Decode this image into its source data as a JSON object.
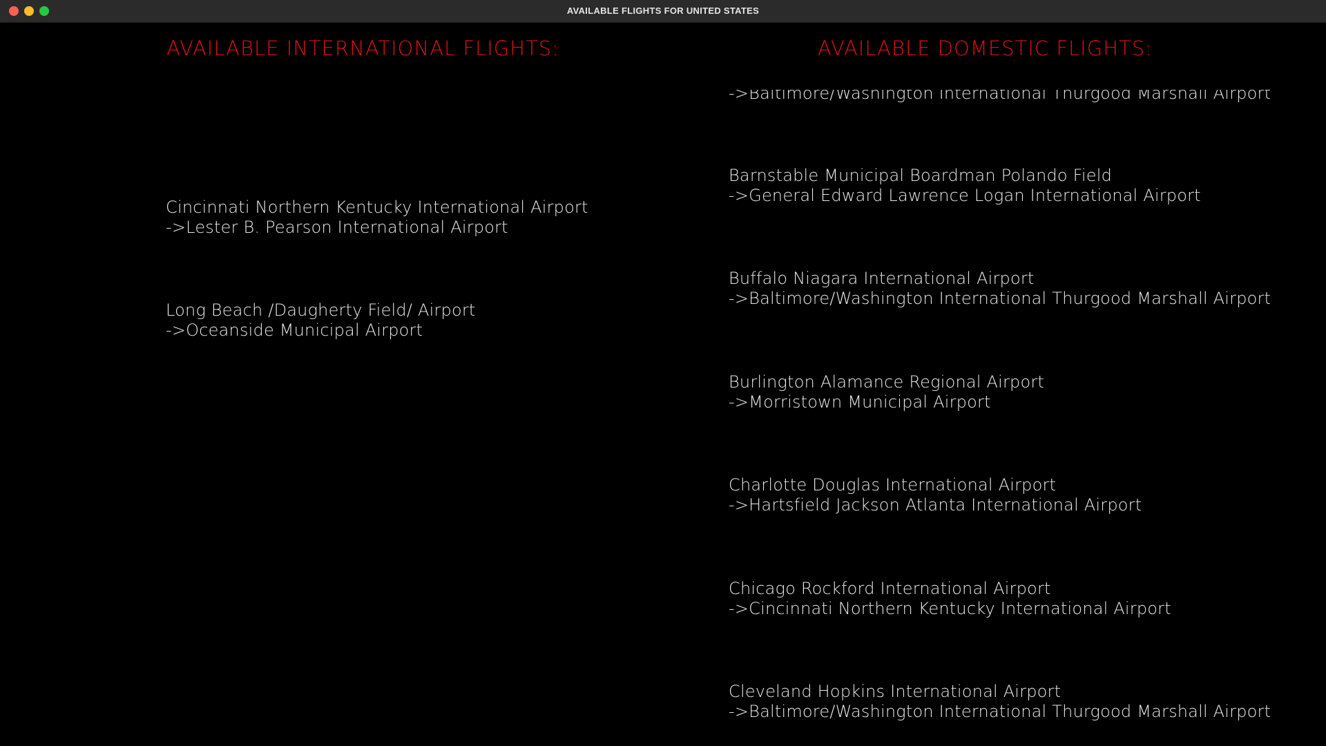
{
  "window": {
    "title": "AVAILABLE FLIGHTS FOR UNITED STATES"
  },
  "international": {
    "heading": "AVAILABLE INTERNATIONAL FLIGHTS:",
    "flights": [
      {
        "origin": "Cincinnati Northern Kentucky International Airport",
        "destination": "->Lester B. Pearson International Airport"
      },
      {
        "origin": "Long Beach /Daugherty Field/ Airport",
        "destination": "->Oceanside Municipal Airport"
      }
    ]
  },
  "domestic": {
    "heading": "AVAILABLE DOMESTIC FLIGHTS:",
    "flights": [
      {
        "origin": "",
        "destination": "->Baltimore/Washington International Thurgood Marshall Airport"
      },
      {
        "origin": "Barnstable Municipal Boardman Polando Field",
        "destination": "->General Edward Lawrence Logan International Airport"
      },
      {
        "origin": "Buffalo Niagara International Airport",
        "destination": "->Baltimore/Washington International Thurgood Marshall Airport"
      },
      {
        "origin": "Burlington Alamance Regional Airport",
        "destination": "->Morristown Municipal Airport"
      },
      {
        "origin": "Charlotte Douglas International Airport",
        "destination": "->Hartsfield Jackson Atlanta International Airport"
      },
      {
        "origin": "Chicago Rockford International Airport",
        "destination": "->Cincinnati Northern Kentucky International Airport"
      },
      {
        "origin": "Cleveland Hopkins International Airport",
        "destination": "->Baltimore/Washington International Thurgood Marshall Airport"
      }
    ]
  }
}
